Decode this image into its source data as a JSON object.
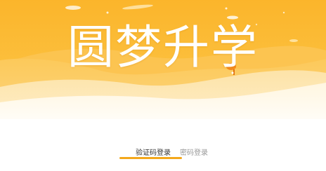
{
  "hero": {
    "title": "圆梦升学"
  },
  "tabs": [
    {
      "label": "验证码登录",
      "active": true
    },
    {
      "label": "密码登录",
      "active": false
    }
  ],
  "colors": {
    "accent": "#f4a81c",
    "banner_top": "#fbb52b",
    "banner_wave": "#fdd784",
    "active_text": "#333333",
    "inactive_text": "#999999"
  }
}
